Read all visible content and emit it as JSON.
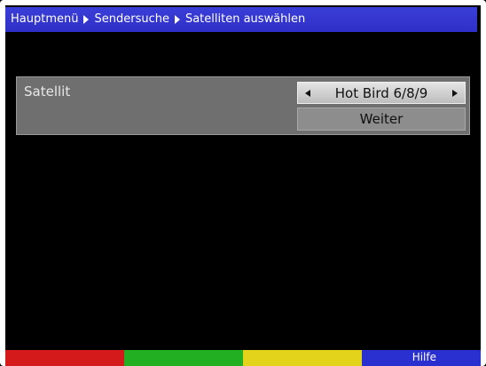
{
  "breadcrumb": [
    "Hauptmenü",
    "Sendersuche",
    "Satelliten auswählen"
  ],
  "settings": {
    "satellite_label": "Satellit",
    "satellite_value": "Hot Bird 6/8/9",
    "next_label": "Weiter"
  },
  "color_keys": {
    "red": {
      "color": "#d41a1a",
      "label": ""
    },
    "green": {
      "color": "#22b022",
      "label": ""
    },
    "yellow": {
      "color": "#e3d31a",
      "label": ""
    },
    "blue": {
      "color": "#2a2fd0",
      "label": "Hilfe"
    }
  }
}
